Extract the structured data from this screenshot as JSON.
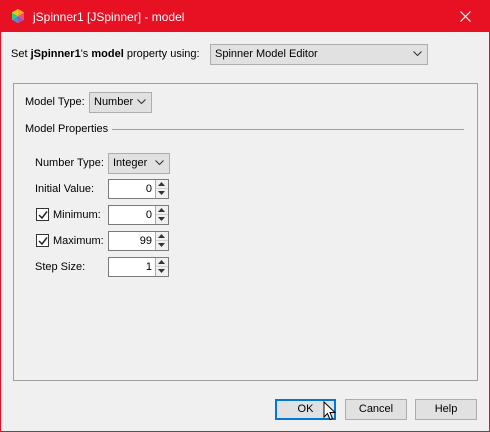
{
  "window": {
    "title": "jSpinner1 [JSpinner] - model",
    "icons": {
      "app": "app-logo-icon",
      "close": "close-icon"
    },
    "colors": {
      "titlebar": "#e81123"
    }
  },
  "editor_select": {
    "prefix": "Set ",
    "component": "jSpinner1",
    "possessive": "'s ",
    "property": "model",
    "suffix": " property using:",
    "value": "Spinner Model Editor"
  },
  "model_type": {
    "label": "Model Type:",
    "value": "Number"
  },
  "model_properties": {
    "heading": "Model Properties",
    "number_type": {
      "label": "Number Type:",
      "value": "Integer"
    },
    "initial_value": {
      "label": "Initial Value:",
      "value": "0"
    },
    "minimum": {
      "label": "Minimum:",
      "value": "0",
      "checked": true
    },
    "maximum": {
      "label": "Maximum:",
      "value": "99",
      "checked": true
    },
    "step_size": {
      "label": "Step Size:",
      "value": "1"
    }
  },
  "buttons": {
    "ok": "OK",
    "cancel": "Cancel",
    "help": "Help"
  }
}
